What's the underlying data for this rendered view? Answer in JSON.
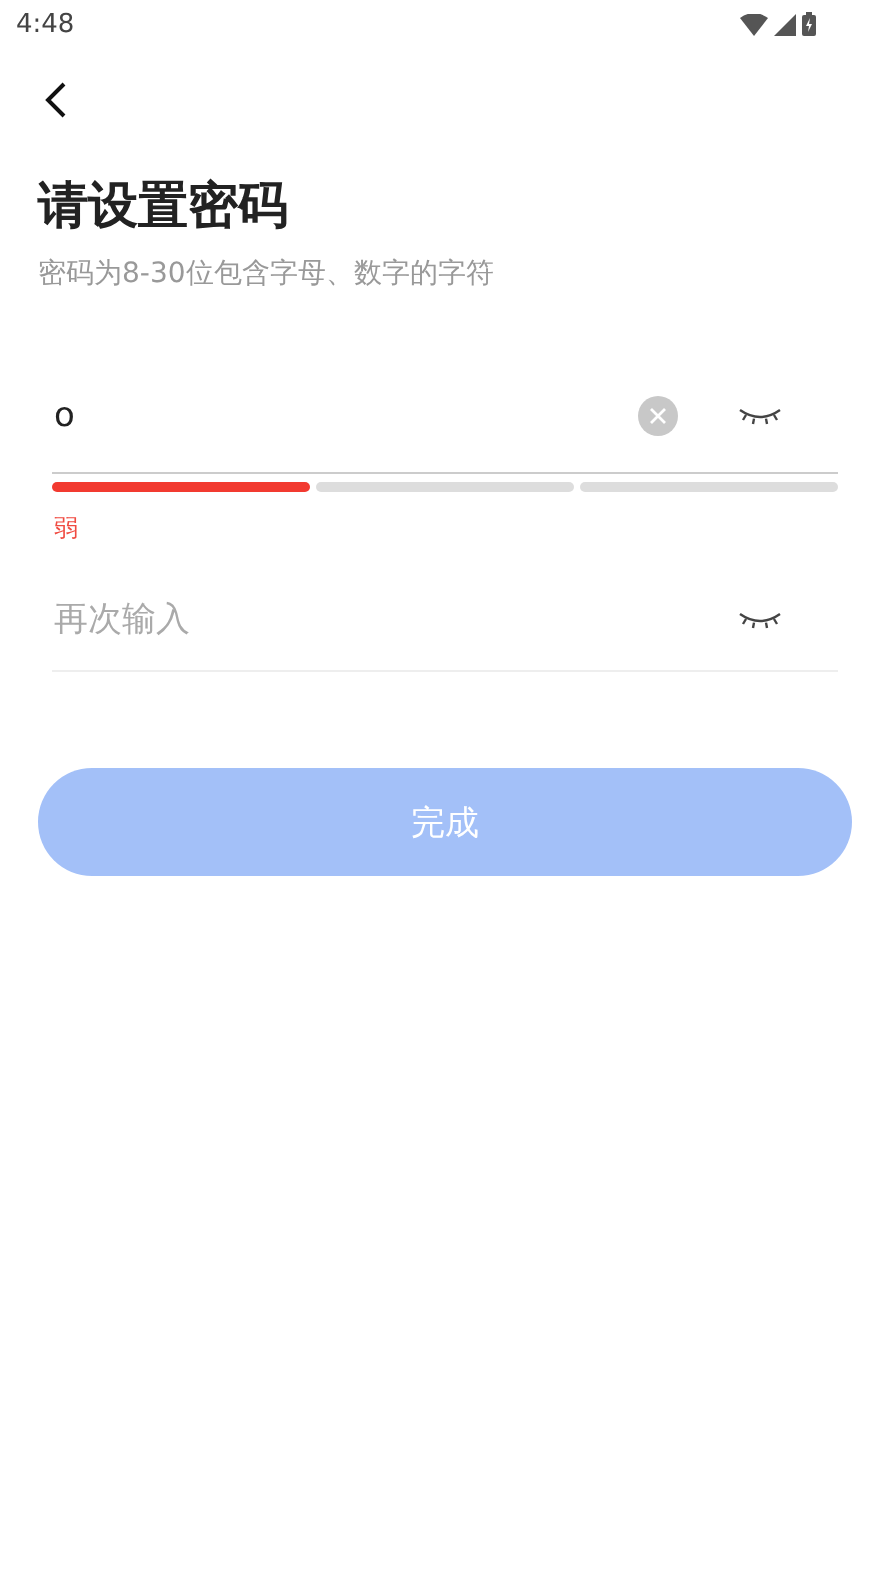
{
  "status_bar": {
    "time": "4:48"
  },
  "title": "请设置密码",
  "subtitle": "密码为8-30位包含字母、数字的字符",
  "password_field": {
    "value": "o"
  },
  "strength": {
    "segments": [
      {
        "filled": true
      },
      {
        "filled": false
      },
      {
        "filled": false
      }
    ],
    "label": "弱"
  },
  "confirm_field": {
    "placeholder": "再次输入"
  },
  "done_button": {
    "label": "完成",
    "disabled": true
  }
}
